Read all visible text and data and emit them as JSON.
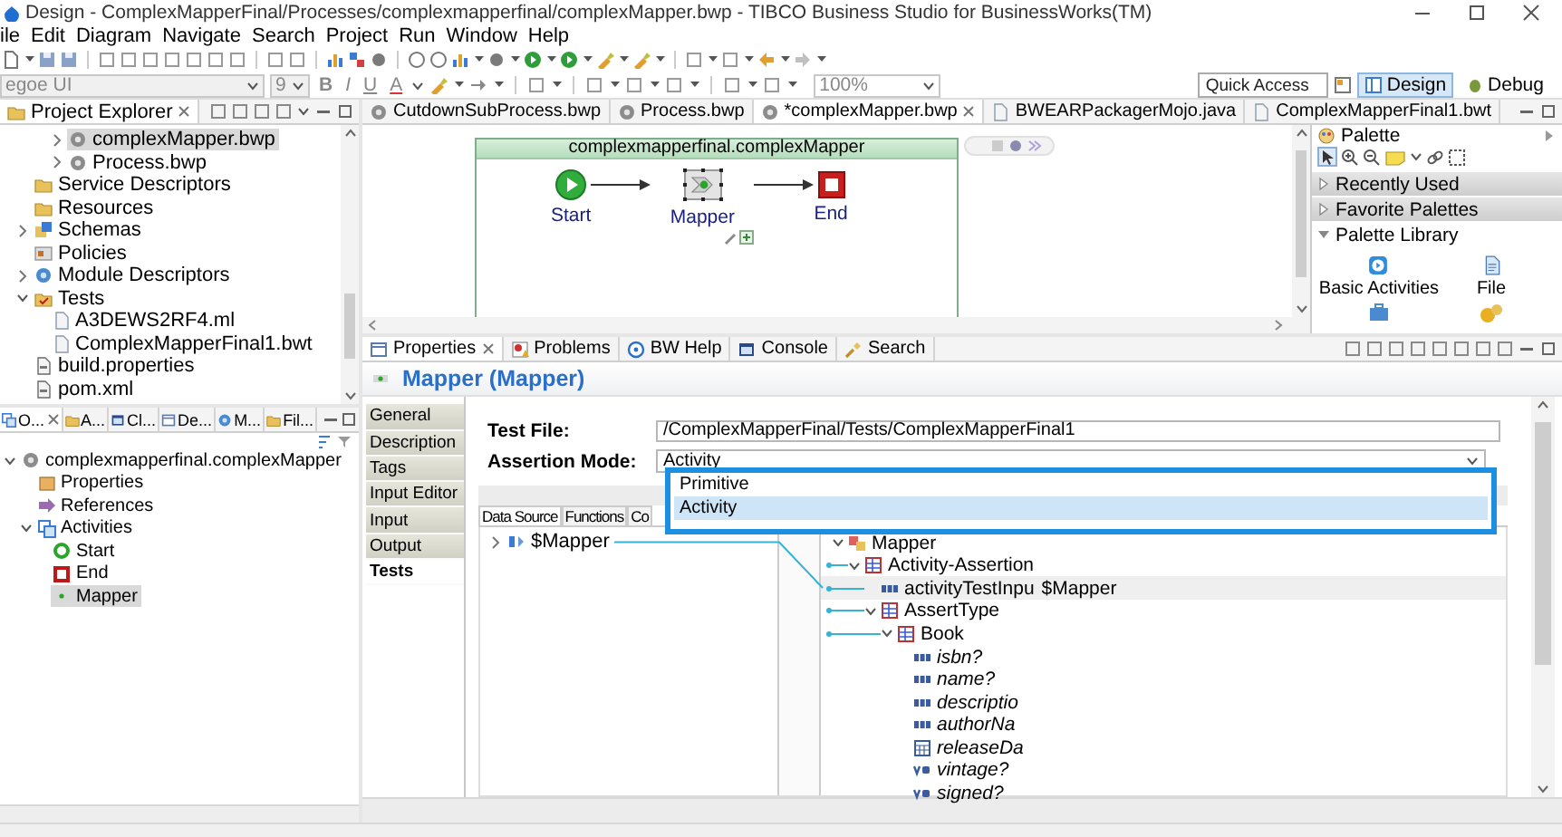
{
  "window": {
    "title": "Design - ComplexMapperFinal/Processes/complexmapperfinal/complexMapper.bwp - TIBCO Business Studio for BusinessWorks(TM)"
  },
  "menu": [
    "ile",
    "Edit",
    "Diagram",
    "Navigate",
    "Search",
    "Project",
    "Run",
    "Window",
    "Help"
  ],
  "format_bar": {
    "font": "egoe UI",
    "size": "9",
    "disabled": true,
    "styles": [
      {
        "label": "B",
        "kind": "bold"
      },
      {
        "label": "I",
        "kind": "italic"
      },
      {
        "label": "U",
        "kind": "underline"
      },
      {
        "label": "A",
        "kind": "color"
      }
    ],
    "zoom": "100%"
  },
  "quick_access": {
    "placeholder": "Quick Access"
  },
  "perspectives": [
    {
      "label": "Design",
      "selected": true
    },
    {
      "label": "Debug",
      "selected": false
    }
  ],
  "project_explorer": {
    "title": "Project Explorer",
    "items": [
      {
        "children": [
          {
            "children": [
              {
                "label": "complexMapper.bwp",
                "kind": "process",
                "expanded": false,
                "selected": true
              },
              {
                "label": "Process.bwp",
                "kind": "process",
                "expanded": false,
                "selected": false
              }
            ]
          }
        ]
      },
      {
        "label": "Service Descriptors",
        "kind": "folder",
        "selected": false
      },
      {
        "label": "Resources",
        "kind": "folder",
        "selected": false
      },
      {
        "label": "Schemas",
        "kind": "schema",
        "expanded": false,
        "selected": false
      },
      {
        "label": "Policies",
        "kind": "policy",
        "selected": false
      },
      {
        "label": "Module Descriptors",
        "kind": "module",
        "expanded": false,
        "selected": false
      },
      {
        "label": "Tests",
        "kind": "tests",
        "expanded": true,
        "selected": false,
        "children": [
          {
            "label": "A3DEWS2RF4.ml",
            "kind": "file",
            "selected": false
          },
          {
            "label": "ComplexMapperFinal1.bwt",
            "kind": "file",
            "selected": false
          }
        ]
      },
      {
        "label": "build.properties",
        "kind": "textfile",
        "selected": false
      },
      {
        "label": "pom.xml",
        "kind": "textfile",
        "selected": false
      }
    ]
  },
  "outline": {
    "tabs": [
      {
        "label": "O...",
        "selected": true
      },
      {
        "label": "A...",
        "selected": false
      },
      {
        "label": "Cl...",
        "selected": false
      },
      {
        "label": "De...",
        "selected": false
      },
      {
        "label": "M...",
        "selected": false
      },
      {
        "label": "Fil...",
        "selected": false
      }
    ],
    "items": [
      {
        "label": "complexmapperfinal.complexMapper",
        "kind": "process",
        "expanded": true,
        "selected": false,
        "children": [
          {
            "label": "Properties",
            "kind": "props",
            "selected": false
          },
          {
            "label": "References",
            "kind": "references",
            "selected": false
          },
          {
            "label": "Activities",
            "kind": "activities",
            "expanded": true,
            "selected": false,
            "children": [
              {
                "label": "Start",
                "kind": "start",
                "selected": false
              },
              {
                "label": "End",
                "kind": "end",
                "selected": false
              },
              {
                "label": "Mapper",
                "kind": "activity",
                "selected": true
              }
            ]
          }
        ]
      }
    ]
  },
  "editor": {
    "tabs": [
      {
        "label": "CutdownSubProcess.bwp",
        "kind": "process",
        "selected": false
      },
      {
        "label": "Process.bwp",
        "kind": "process",
        "selected": false
      },
      {
        "label": "*complexMapper.bwp",
        "kind": "process",
        "selected": true
      },
      {
        "label": "BWEARPackagerMojo.java",
        "kind": "file",
        "selected": false
      },
      {
        "label": "ComplexMapperFinal1.bwt",
        "kind": "file",
        "selected": false
      }
    ],
    "process": {
      "title": "complexmapperfinal.complexMapper",
      "nodes": [
        {
          "label": "Start",
          "kind": "start",
          "selected": false
        },
        {
          "label": "Mapper",
          "kind": "activity",
          "selected": true
        },
        {
          "label": "End",
          "kind": "end",
          "selected": false
        }
      ]
    }
  },
  "palette": {
    "title": "Palette",
    "drawers": [
      {
        "label": "Recently Used",
        "expanded": false
      },
      {
        "label": "Favorite Palettes",
        "expanded": false
      },
      {
        "label": "Palette Library",
        "expanded": true
      }
    ],
    "items": [
      {
        "label": "Basic Activities",
        "kind": "basic"
      },
      {
        "label": "File",
        "kind": "file"
      }
    ]
  },
  "properties": {
    "tabs": [
      {
        "label": "Properties",
        "kind": "properties",
        "selected": true
      },
      {
        "label": "Problems",
        "kind": "problems",
        "selected": false
      },
      {
        "label": "BW Help",
        "kind": "help",
        "selected": false
      },
      {
        "label": "Console",
        "kind": "console",
        "selected": false
      },
      {
        "label": "Search",
        "kind": "search",
        "selected": false
      }
    ],
    "title": "Mapper (Mapper)",
    "sections": [
      {
        "label": "General",
        "selected": false
      },
      {
        "label": "Description",
        "selected": false
      },
      {
        "label": "Tags",
        "selected": false
      },
      {
        "label": "Input Editor",
        "selected": false
      },
      {
        "label": "Input",
        "selected": false
      },
      {
        "label": "Output",
        "selected": false
      },
      {
        "label": "Tests",
        "selected": true
      }
    ],
    "test_file": {
      "label": "Test File:",
      "value": "/ComplexMapperFinal/Tests/ComplexMapperFinal1"
    },
    "assertion_mode": {
      "label": "Assertion Mode:",
      "value": "Activity",
      "expanded": true,
      "options": [
        {
          "label": "Primitive",
          "selected": false
        },
        {
          "label": "Activity",
          "selected": true
        }
      ]
    },
    "mapper": {
      "tabs": [
        {
          "label": "Data Source",
          "selected": true
        },
        {
          "label": "Functions",
          "selected": false
        },
        {
          "label": "Co",
          "selected": false
        }
      ],
      "source": [
        {
          "label": "$Mapper",
          "kind": "variable",
          "expanded": false
        }
      ],
      "target": [
        {
          "label": "Mapper",
          "kind": "root",
          "expanded": true,
          "mapped": false,
          "optional": false,
          "selected": false,
          "children": [
            {
              "label": "Activity-Assertion",
              "kind": "element",
              "expanded": true,
              "mapped": true,
              "optional": false,
              "selected": false,
              "children": [
                {
                  "label": "activityTestInpu",
                  "kind": "string",
                  "mapped": true,
                  "optional": false,
                  "selected": true,
                  "binding": "$Mapper"
                },
                {
                  "label": "AssertType",
                  "kind": "element",
                  "expanded": true,
                  "mapped": true,
                  "optional": false,
                  "selected": false,
                  "children": [
                    {
                      "label": "Book",
                      "kind": "element",
                      "expanded": true,
                      "mapped": true,
                      "optional": false,
                      "selected": false,
                      "children": [
                        {
                          "label": "isbn?",
                          "kind": "string",
                          "mapped": false,
                          "optional": true,
                          "selected": false
                        },
                        {
                          "label": "name?",
                          "kind": "string",
                          "mapped": false,
                          "optional": true,
                          "selected": false
                        },
                        {
                          "label": "descriptio",
                          "kind": "string",
                          "mapped": false,
                          "optional": true,
                          "selected": false
                        },
                        {
                          "label": "authorNa",
                          "kind": "string",
                          "mapped": false,
                          "optional": true,
                          "selected": false
                        },
                        {
                          "label": "releaseDa",
                          "kind": "date",
                          "mapped": false,
                          "optional": true,
                          "selected": false
                        },
                        {
                          "label": "vintage?",
                          "kind": "boolean",
                          "mapped": false,
                          "optional": true,
                          "selected": false
                        },
                        {
                          "label": "signed?",
                          "kind": "boolean",
                          "mapped": false,
                          "optional": true,
                          "selected": false
                        }
                      ]
                    }
                  ]
                }
              ]
            }
          ]
        }
      ]
    }
  }
}
